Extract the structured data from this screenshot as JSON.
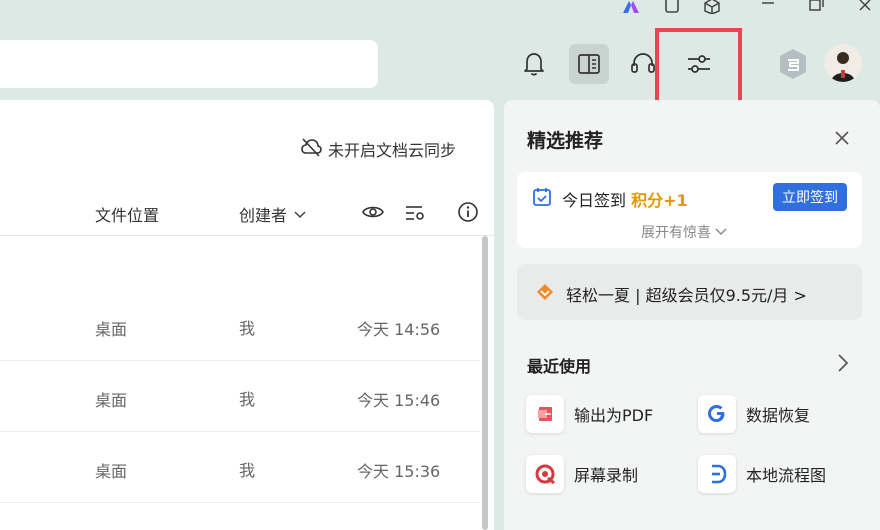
{
  "titlebar": {
    "icons": [
      "app-logo-icon",
      "tablet-icon",
      "cube-icon",
      "minimize-icon",
      "restore-icon",
      "close-icon"
    ]
  },
  "header": {
    "icons": [
      "bell-icon",
      "sidebar-panel-icon",
      "headset-icon",
      "settings-sliders-icon",
      "shield-badge-icon",
      "avatar"
    ]
  },
  "file_list": {
    "sync_status": "未开启文档云同步",
    "columns": {
      "location": "文件位置",
      "creator": "创建者"
    },
    "rows": [
      {
        "location": "桌面",
        "creator": "我",
        "time": "今天 14:56"
      },
      {
        "location": "桌面",
        "creator": "我",
        "time": "今天 15:46"
      },
      {
        "location": "桌面",
        "creator": "我",
        "time": "今天 15:36"
      }
    ]
  },
  "recommend_panel": {
    "title": "精选推荐",
    "signin": {
      "text": "今日签到",
      "points": "积分+1",
      "button": "立即签到",
      "expand": "展开有惊喜"
    },
    "promo": "轻松一夏 | 超级会员仅9.5元/月 >",
    "recent": {
      "title": "最近使用",
      "tools": [
        {
          "label": "输出为PDF"
        },
        {
          "label": "数据恢复"
        },
        {
          "label": "屏幕录制"
        },
        {
          "label": "本地流程图"
        }
      ]
    }
  },
  "colors": {
    "background": "#dde9e5",
    "accent_blue": "#2f6fe0",
    "points_orange": "#e09a00",
    "highlight_red": "#e5464f"
  }
}
